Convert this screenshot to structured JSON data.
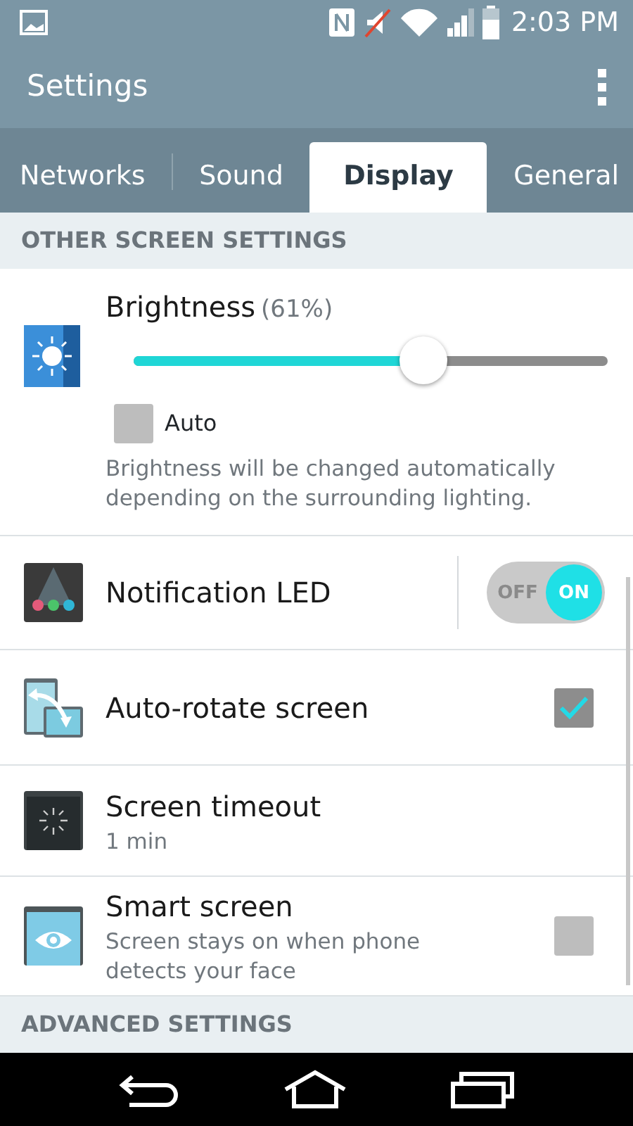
{
  "status_bar": {
    "time": "2:03 PM"
  },
  "app_bar": {
    "title": "Settings"
  },
  "tabs": [
    {
      "label": "Networks",
      "selected": false
    },
    {
      "label": "Sound",
      "selected": false
    },
    {
      "label": "Display",
      "selected": true
    },
    {
      "label": "General",
      "selected": false
    }
  ],
  "sections": [
    {
      "header": "OTHER SCREEN SETTINGS",
      "items": [
        {
          "kind": "slider",
          "title": "Brightness",
          "reading": "(61%)",
          "level": 0.61,
          "auto_label": "Auto",
          "auto_checked": false,
          "description": "Brightness will be changed automatically depending on the surrounding lighting."
        },
        {
          "kind": "switch",
          "title": "Notification LED",
          "off_label": "OFF",
          "on_label": "ON",
          "on": true
        },
        {
          "kind": "checkbox",
          "title": "Auto-rotate screen",
          "checked": true
        },
        {
          "kind": "value",
          "title": "Screen timeout",
          "summary": "1 min"
        },
        {
          "kind": "checkbox",
          "title": "Smart screen",
          "summary": "Screen stays on when phone detects your face",
          "checked": false
        }
      ]
    },
    {
      "header": "ADVANCED SETTINGS"
    }
  ]
}
